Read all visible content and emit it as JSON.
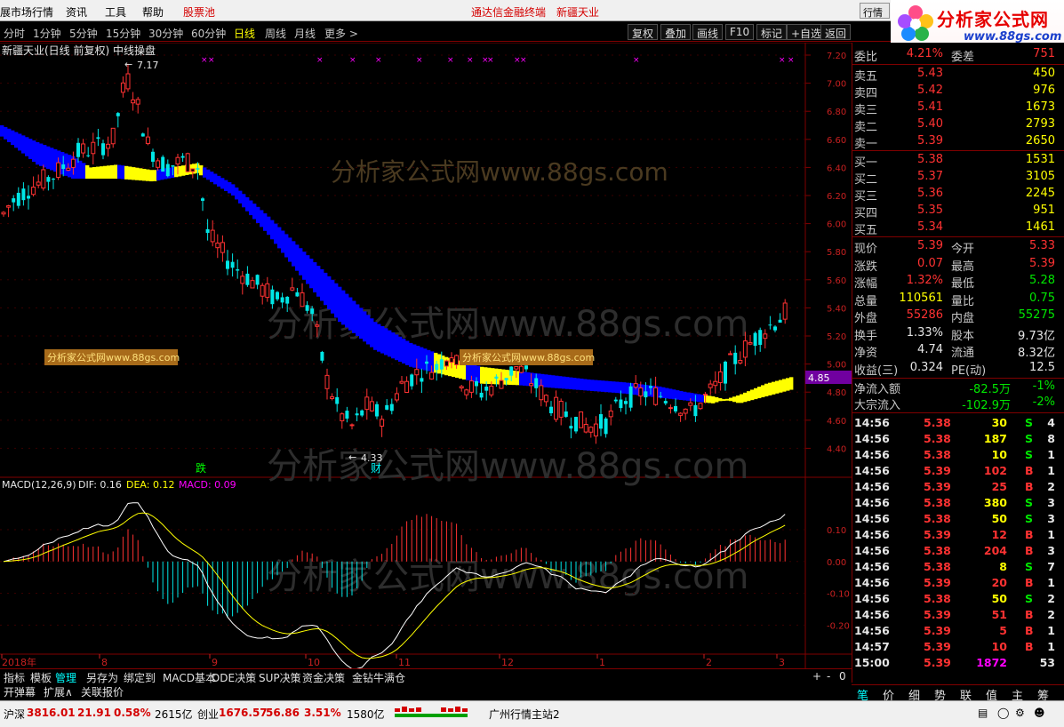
{
  "menu": {
    "items": [
      "展市场行情",
      "资讯",
      "工具",
      "帮助"
    ],
    "stock_pool": "股票池",
    "center_title": "通达信金融终端",
    "center_stock": "新疆天业",
    "trade_label": "行情"
  },
  "logo": {
    "title": "分析家公式网",
    "url": "www.88gs.com"
  },
  "periods": [
    "分时",
    "1分钟",
    "5分钟",
    "15分钟",
    "30分钟",
    "60分钟",
    "日线",
    "周线",
    "月线",
    "更多 >"
  ],
  "active_period": "日线",
  "tools": [
    "复权",
    "叠加",
    "画线",
    "F10",
    "标记",
    "+自选",
    "返回"
  ],
  "chart": {
    "header": "新疆天业(日线 前复权) 中线操盘",
    "price_ticks": [
      "7.20",
      "7.00",
      "6.80",
      "6.60",
      "6.40",
      "6.20",
      "6.00",
      "5.80",
      "5.60",
      "5.40",
      "5.20",
      "5.00",
      "4.80",
      "4.60",
      "4.40"
    ],
    "current_price_label": "4.85",
    "high_label": "7.17",
    "low_label": "4.33",
    "signal_die": "跌",
    "signal_cai": "财",
    "watermark": "分析家公式网www.88gs.com",
    "watermark_small": "分析家公式网www.88gs.com",
    "macd_header": {
      "name": "MACD(12,26,9)",
      "dif": "DIF: 0.16",
      "dea": "DEA: 0.12",
      "macd": "MACD: 0.09"
    },
    "macd_ticks": [
      "0.10",
      "0.00",
      "-0.10",
      "-0.20"
    ],
    "date_labels": [
      "2018年",
      "8",
      "9",
      "10",
      "11",
      "12",
      "1",
      "2",
      "3"
    ]
  },
  "chart_data": {
    "type": "candlestick",
    "title": "新疆天业(日线 前复权) 中线操盘",
    "ylim": [
      4.2,
      7.3
    ],
    "y_high": 7.17,
    "y_low": 4.33,
    "last_price": 5.39,
    "macd": {
      "dif": 0.16,
      "dea": 0.12,
      "macd": 0.09,
      "ylim": [
        -0.28,
        0.22
      ]
    }
  },
  "quote": {
    "weibi": {
      "label": "委比",
      "value": "4.21%",
      "label2": "委差",
      "value2": "751"
    },
    "sell": [
      {
        "label": "卖五",
        "price": "5.43",
        "vol": "450"
      },
      {
        "label": "卖四",
        "price": "5.42",
        "vol": "976"
      },
      {
        "label": "卖三",
        "price": "5.41",
        "vol": "1673"
      },
      {
        "label": "卖二",
        "price": "5.40",
        "vol": "2793"
      },
      {
        "label": "卖一",
        "price": "5.39",
        "vol": "2650"
      }
    ],
    "buy": [
      {
        "label": "买一",
        "price": "5.38",
        "vol": "1531"
      },
      {
        "label": "买二",
        "price": "5.37",
        "vol": "3105"
      },
      {
        "label": "买三",
        "price": "5.36",
        "vol": "2245"
      },
      {
        "label": "买四",
        "price": "5.35",
        "vol": "951"
      },
      {
        "label": "买五",
        "price": "5.34",
        "vol": "1461"
      }
    ],
    "stats": [
      {
        "l1": "现价",
        "v1": "5.39",
        "c1": "red",
        "l2": "今开",
        "v2": "5.33",
        "c2": "red"
      },
      {
        "l1": "涨跌",
        "v1": "0.07",
        "c1": "red",
        "l2": "最高",
        "v2": "5.39",
        "c2": "red"
      },
      {
        "l1": "涨幅",
        "v1": "1.32%",
        "c1": "red",
        "l2": "最低",
        "v2": "5.28",
        "c2": "green"
      },
      {
        "l1": "总量",
        "v1": "110561",
        "c1": "yellow",
        "l2": "量比",
        "v2": "0.75",
        "c2": "green"
      },
      {
        "l1": "外盘",
        "v1": "55286",
        "c1": "red",
        "l2": "内盘",
        "v2": "55275",
        "c2": "green"
      },
      {
        "l1": "换手",
        "v1": "1.33%",
        "c1": "white",
        "l2": "股本",
        "v2": "9.73亿",
        "c2": "white"
      },
      {
        "l1": "净资",
        "v1": "4.74",
        "c1": "white",
        "l2": "流通",
        "v2": "8.32亿",
        "c2": "white"
      },
      {
        "l1": "收益(三)",
        "v1": "0.324",
        "c1": "white",
        "l2": "PE(动)",
        "v2": "12.5",
        "c2": "white"
      }
    ],
    "flows": [
      {
        "label": "净流入额",
        "value": "-82.5万",
        "pct": "-1%"
      },
      {
        "label": "大宗流入",
        "value": "-102.9万",
        "pct": "-2%"
      }
    ],
    "ticks": [
      {
        "t": "14:56",
        "p": "5.38",
        "v": "30",
        "s": "S",
        "n": "4"
      },
      {
        "t": "14:56",
        "p": "5.38",
        "v": "187",
        "s": "S",
        "n": "8"
      },
      {
        "t": "14:56",
        "p": "5.38",
        "v": "10",
        "s": "S",
        "n": "1"
      },
      {
        "t": "14:56",
        "p": "5.39",
        "v": "102",
        "s": "B",
        "n": "1"
      },
      {
        "t": "14:56",
        "p": "5.39",
        "v": "25",
        "s": "B",
        "n": "2"
      },
      {
        "t": "14:56",
        "p": "5.38",
        "v": "380",
        "s": "S",
        "n": "3"
      },
      {
        "t": "14:56",
        "p": "5.38",
        "v": "50",
        "s": "S",
        "n": "3"
      },
      {
        "t": "14:56",
        "p": "5.39",
        "v": "12",
        "s": "B",
        "n": "1"
      },
      {
        "t": "14:56",
        "p": "5.38",
        "v": "204",
        "s": "B",
        "n": "3"
      },
      {
        "t": "14:56",
        "p": "5.38",
        "v": "8",
        "s": "S",
        "n": "7"
      },
      {
        "t": "14:56",
        "p": "5.39",
        "v": "20",
        "s": "B",
        "n": "1"
      },
      {
        "t": "14:56",
        "p": "5.38",
        "v": "50",
        "s": "S",
        "n": "2"
      },
      {
        "t": "14:56",
        "p": "5.39",
        "v": "51",
        "s": "B",
        "n": "2"
      },
      {
        "t": "14:56",
        "p": "5.39",
        "v": "5",
        "s": "B",
        "n": "1"
      },
      {
        "t": "14:57",
        "p": "5.39",
        "v": "10",
        "s": "B",
        "n": "1"
      },
      {
        "t": "15:00",
        "p": "5.39",
        "v": "1872",
        "s": "",
        "n": "53"
      }
    ]
  },
  "tabs1": [
    "指标",
    "模板",
    "管理",
    "另存为",
    "绑定到",
    "MACD基本",
    "DDE决策",
    "SUP决策",
    "资金决策",
    "金钻牛满仓"
  ],
  "tabs1_active": "管理",
  "tabs2": [
    "开弹幕",
    "扩展∧",
    "关联报价"
  ],
  "side_tabs": [
    "笔",
    "价",
    "细",
    "势",
    "联",
    "值",
    "主",
    "筹"
  ],
  "status": {
    "sh_label": "沪深",
    "sh_value": "3816.01",
    "sh_change": "21.91",
    "sh_pct": "0.58%",
    "sh_amount": "2615亿",
    "cy_label": "创业",
    "cy_value": "1676.57",
    "cy_change": "56.86",
    "cy_pct": "3.51%",
    "cy_amount": "1580亿",
    "server": "广州行情主站2"
  },
  "colors": {
    "up": "#ff3232",
    "down": "#00e6e6",
    "band_blue": "#0000ff",
    "band_yellow": "#ffff00",
    "grid": "#800000"
  }
}
